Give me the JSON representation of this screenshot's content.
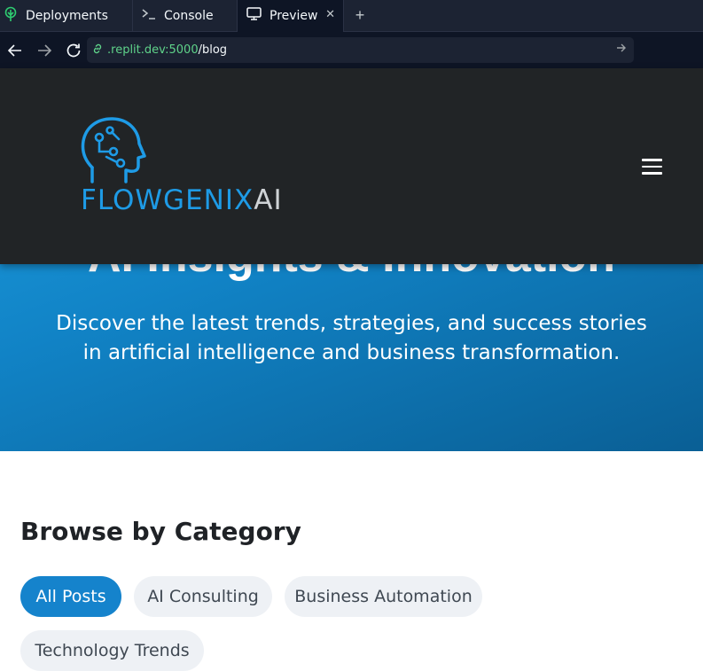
{
  "tabs": [
    {
      "label": "Deployments",
      "icon": "deployments-icon"
    },
    {
      "label": "Console",
      "icon": "terminal-icon"
    },
    {
      "label": "Preview",
      "icon": "monitor-icon",
      "active": true
    }
  ],
  "address": {
    "host": ".replit.dev:5000",
    "path": "/blog"
  },
  "brand": {
    "name_primary": "FLOWGENIX",
    "name_secondary": "AI",
    "accent": "#1e9be6"
  },
  "hero": {
    "title": "AI Insights & Innovation",
    "subtitle": "Discover the latest trends, strategies, and success stories in artificial intelligence and business transformation."
  },
  "categories": {
    "title": "Browse by Category",
    "items": [
      "All Posts",
      "AI Consulting",
      "Business Automation",
      "Technology Trends"
    ],
    "active": "All Posts"
  },
  "colors": {
    "chrome": "#1c2333",
    "header": "#212426",
    "chip_active": "#1583cc",
    "chip": "#eef1f5"
  }
}
